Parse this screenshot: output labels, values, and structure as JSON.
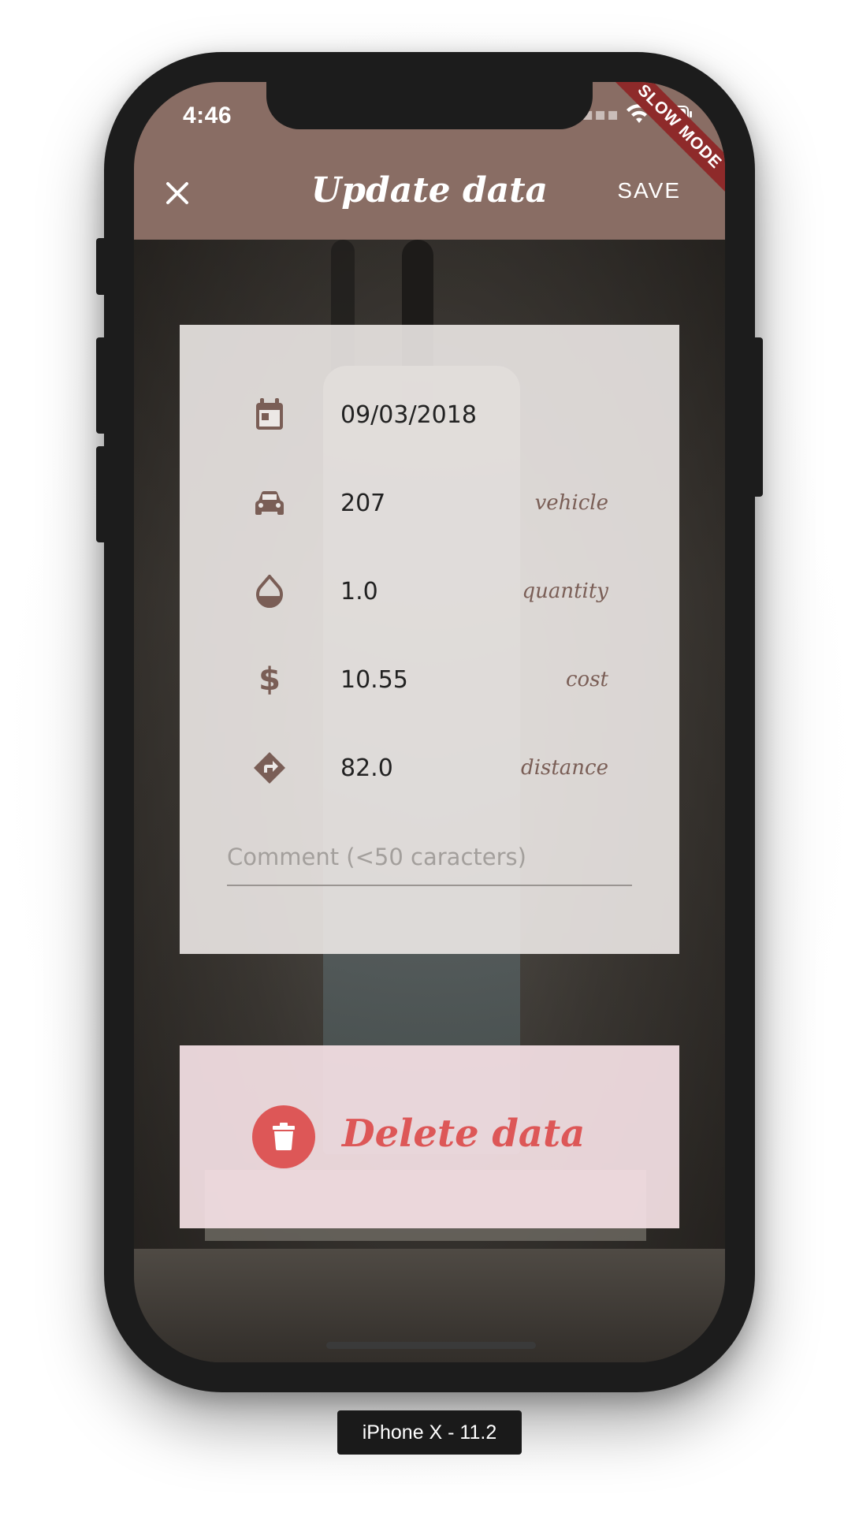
{
  "status_bar": {
    "time": "4:46",
    "debug_banner": "SLOW MODE"
  },
  "app_bar": {
    "title": "Update data",
    "close_icon": "close-icon",
    "save_label": "SAVE",
    "background": "#896d64"
  },
  "form": {
    "date": {
      "icon": "calendar-icon",
      "value": "09/03/2018"
    },
    "vehicle": {
      "icon": "car-icon",
      "value": "207",
      "label": "vehicle"
    },
    "quantity": {
      "icon": "drop-icon",
      "value": "1.0",
      "label": "quantity"
    },
    "cost": {
      "icon": "dollar-icon",
      "value": "10.55",
      "label": "cost"
    },
    "distance": {
      "icon": "directions-icon",
      "value": "82.0",
      "label": "distance"
    },
    "comment": {
      "placeholder": "Comment (<50 caracters)",
      "value": ""
    }
  },
  "delete": {
    "icon": "trash-icon",
    "label": "Delete data",
    "color": "#dd5757"
  },
  "device_label": "iPhone X - 11.2",
  "colors": {
    "accent": "#7a5e56",
    "icon": "#7a5e56"
  }
}
